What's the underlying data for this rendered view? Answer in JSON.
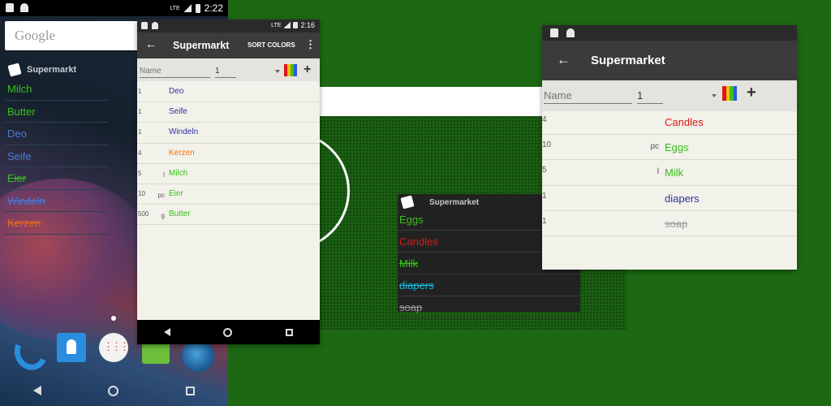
{
  "colors": {
    "toolbar": "#3b3b3b",
    "list_background": "#f2f1ea",
    "background_green": "#1d6813",
    "red": "#e01616",
    "green": "#39c11a",
    "dark_blue": "#2b2fa0",
    "cyan": "#1ab8d8",
    "orange": "#f07010",
    "gray": "#9a9a9a",
    "home_blue": "#4a7ad8",
    "home_orange": "#f06a1a"
  },
  "home_screen": {
    "status_bar": {
      "time": "2:22",
      "network": "LTE"
    },
    "search_bar": {
      "text": "Google",
      "icon": "google-logo"
    },
    "widget": {
      "title": "Supermarkt",
      "icon": "cards-icon",
      "items": [
        {
          "name": "Milch",
          "color": "#39c11a",
          "struck": false
        },
        {
          "name": "Butter",
          "color": "#39c11a",
          "struck": false
        },
        {
          "name": "Deo",
          "color": "#4a7ad8",
          "struck": false
        },
        {
          "name": "Seife",
          "color": "#4a7ad8",
          "struck": false
        },
        {
          "name": "Eier",
          "color": "#39c11a",
          "struck": true
        },
        {
          "name": "Windeln",
          "color": "#4a7ad8",
          "struck": true
        },
        {
          "name": "Kerzen",
          "color": "#f06a1a",
          "struck": true
        }
      ]
    },
    "dock_icons": [
      "phone-icon",
      "contacts-icon",
      "app-drawer-icon",
      "messaging-icon",
      "browser-icon"
    ]
  },
  "german_list": {
    "status_bar": {
      "time": "2:16",
      "network": "LTE"
    },
    "title": "Supermarkt",
    "sort_label": "SORT COLORS",
    "input": {
      "name_placeholder": "Name",
      "quantity": "1"
    },
    "items": [
      {
        "qty": "1",
        "unit": "",
        "name": "Deo",
        "color": "#2b2fa0"
      },
      {
        "qty": "1",
        "unit": "",
        "name": "Seife",
        "color": "#2b2fa0"
      },
      {
        "qty": "1",
        "unit": "",
        "name": "Windeln",
        "color": "#2b2fa0"
      },
      {
        "qty": "4",
        "unit": "",
        "name": "Kerzen",
        "color": "#f07010"
      },
      {
        "qty": "5",
        "unit": "l",
        "name": "Milch",
        "color": "#39c11a"
      },
      {
        "qty": "10",
        "unit": "pc",
        "name": "Eier",
        "color": "#39c11a"
      },
      {
        "qty": "500",
        "unit": "g",
        "name": "Butter",
        "color": "#39c11a"
      }
    ]
  },
  "widget_dark": {
    "title": "Supermarket",
    "icon": "cards-icon",
    "items": [
      {
        "name": "Eggs",
        "color": "#39c11a",
        "struck": false
      },
      {
        "name": "Candles",
        "color": "#e01616",
        "struck": false
      },
      {
        "name": "Milk",
        "color": "#39c11a",
        "struck": true
      },
      {
        "name": "diapers",
        "color": "#1ab8d8",
        "struck": true
      },
      {
        "name": "soap",
        "color": "#9a9a9a",
        "struck": true
      }
    ]
  },
  "english_list": {
    "title": "Supermarket",
    "input": {
      "name_placeholder": "Name",
      "quantity": "1"
    },
    "items": [
      {
        "qty": "4",
        "unit": "",
        "name": "Candles",
        "color": "#e01616",
        "struck": false
      },
      {
        "qty": "10",
        "unit": "pc",
        "name": "Eggs",
        "color": "#39c11a",
        "struck": false
      },
      {
        "qty": "5",
        "unit": "l",
        "name": "Milk",
        "color": "#39c11a",
        "struck": false
      },
      {
        "qty": "1",
        "unit": "",
        "name": "diapers",
        "color": "#2b2fa0",
        "struck": false
      },
      {
        "qty": "1",
        "unit": "",
        "name": "soap",
        "color": "#9a9a9a",
        "struck": true
      }
    ]
  }
}
